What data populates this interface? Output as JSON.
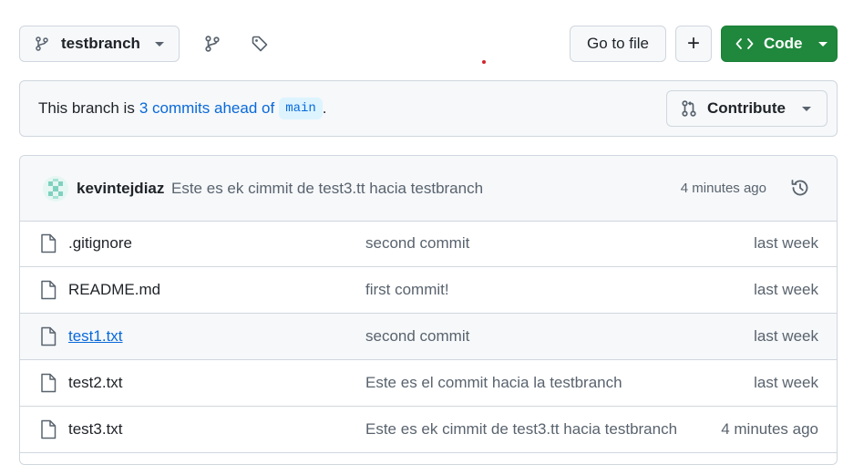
{
  "toolbar": {
    "branch": "testbranch",
    "go_to_file": "Go to file",
    "add": "+",
    "code": "Code"
  },
  "banner": {
    "prefix": "This branch is",
    "link": "3 commits ahead of",
    "base": "main",
    "suffix": ".",
    "contribute": "Contribute"
  },
  "commit": {
    "author": "kevintejdiaz",
    "message": "Este es ek cimmit de test3.tt hacia testbranch",
    "time": "4 minutes ago"
  },
  "files": [
    {
      "name": ".gitignore",
      "message": "second commit",
      "time": "last week"
    },
    {
      "name": "README.md",
      "message": "first commit!",
      "time": "last week"
    },
    {
      "name": "test1.txt",
      "message": "second commit",
      "time": "last week"
    },
    {
      "name": "test2.txt",
      "message": "Este es el commit hacia la testbranch",
      "time": "last week"
    },
    {
      "name": "test3.txt",
      "message": "Este es ek cimmit de test3.tt hacia testbranch",
      "time": "4 minutes ago"
    }
  ],
  "colors": {
    "accent": "#0969da",
    "primary_button": "#1f883d",
    "border": "#d0d7de",
    "muted_bg": "#f6f8fa"
  }
}
